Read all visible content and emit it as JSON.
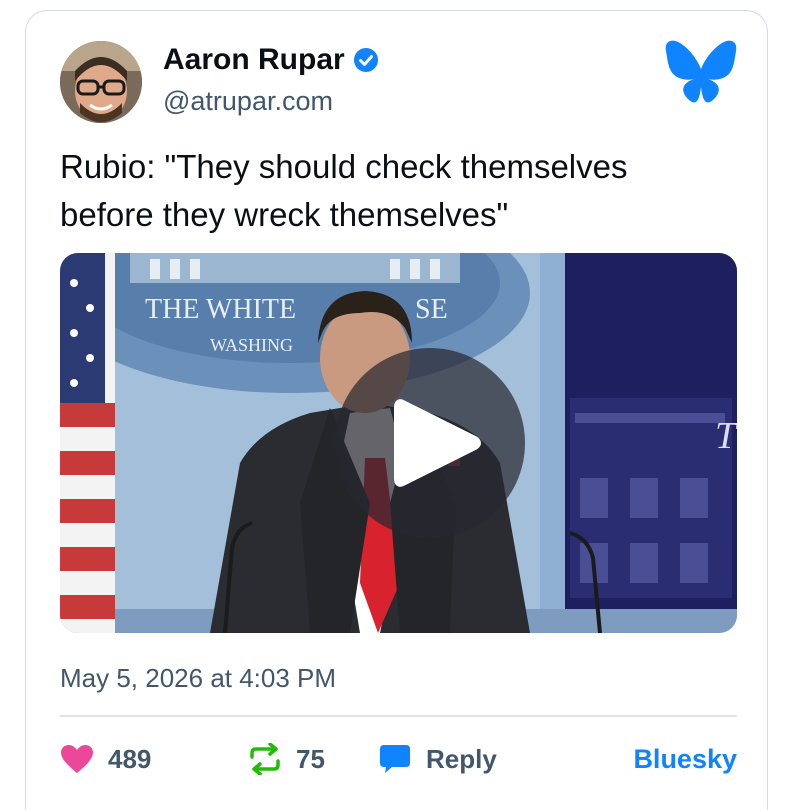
{
  "post": {
    "author": {
      "display_name": "Aaron Rupar",
      "handle": "@atrupar.com",
      "verified": true
    },
    "text": "Rubio: \"They should check themselves\nbefore they wreck themselves\"",
    "video": {
      "background_text_1": "THE WHITE",
      "background_text_2": "SE",
      "background_text_3": "WASHING",
      "background_text_4": "T"
    },
    "timestamp": "May 5, 2026 at 4:03 PM",
    "actions": {
      "likes": "489",
      "reposts": "75",
      "reply_label": "Reply",
      "platform_label": "Bluesky"
    }
  },
  "colors": {
    "brand_blue": "#1083fe",
    "like_pink": "#ec4899",
    "repost_green": "#20bc07",
    "muted_text": "#42576c"
  }
}
